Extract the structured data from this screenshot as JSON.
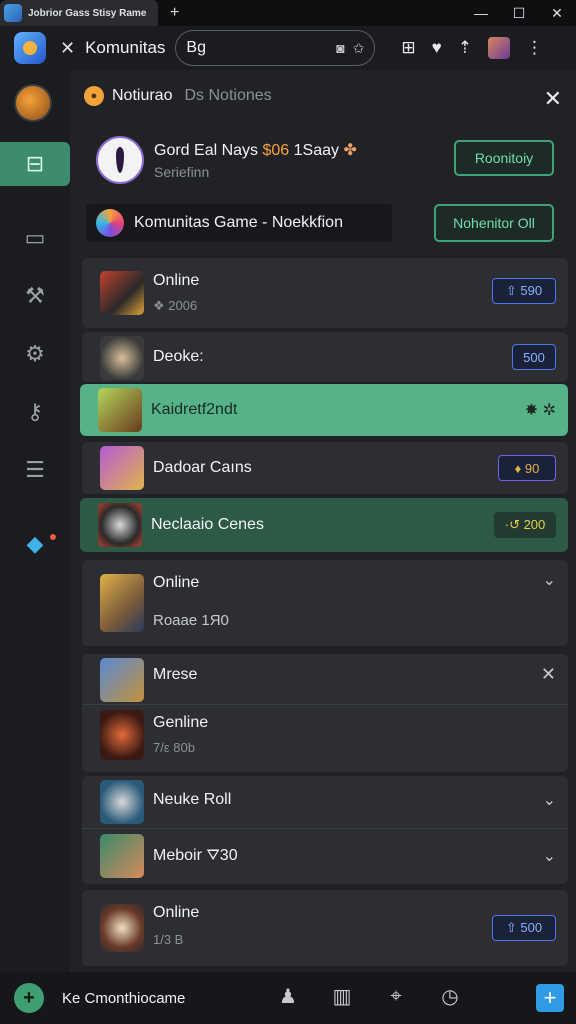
{
  "window": {
    "tab_title": "Jobrior Gass Stisy Rame",
    "new_tab_icon": "plus-icon",
    "controls": [
      "—",
      "☐",
      "✕"
    ]
  },
  "toolbar": {
    "tab_title": "Komunitas",
    "search_value": "Bg",
    "search_placeholder": ""
  },
  "notifications": {
    "title": "Notiurao",
    "subtitle": "Ds Notiones"
  },
  "featured": {
    "title_plain": "Gord Eal Nays ",
    "title_highlight": "$06",
    "title_tail": " 1Saay",
    "subtitle": "Seriefinn",
    "button": "Roonitoiy"
  },
  "community": {
    "label": "Komunitas Game - Noekkfion",
    "button": "Nohenitor Oll"
  },
  "rows": [
    {
      "title": "Online",
      "sub": "❖ 2006",
      "badge": "⇧ 590"
    },
    {
      "title": "Deoke:",
      "sub": "",
      "badge": "500"
    },
    {
      "title": "Kaidretf2ndt",
      "sub": "",
      "badge": "✸ ✲"
    },
    {
      "title": "Dadoar Caıns",
      "sub": "",
      "badge": "♦ 90"
    },
    {
      "title": "Neclaaio Cenes",
      "sub": "",
      "badge": "·↺ 200"
    },
    {
      "title": "Online",
      "sub": "Roaae 1Я0",
      "badge": "⌄"
    },
    {
      "title": "Mrese",
      "sub": "",
      "badge": "✕"
    },
    {
      "title": "Genline",
      "sub": "7/ε 80b",
      "badge": ""
    },
    {
      "title": "Neuke Roll",
      "sub": "",
      "badge": "⌄"
    },
    {
      "title": "Meboir ⛛30",
      "sub": "",
      "badge": "⌄"
    },
    {
      "title": "Online",
      "sub": "1/3 B",
      "badge": "⇧ 500"
    }
  ],
  "bottom": {
    "label": "Ke Cmonthiocame"
  },
  "colors": {
    "accent_green": "#56b287",
    "badge_blue": "#4a78e8",
    "highlight_orange": "#f6a23a"
  }
}
